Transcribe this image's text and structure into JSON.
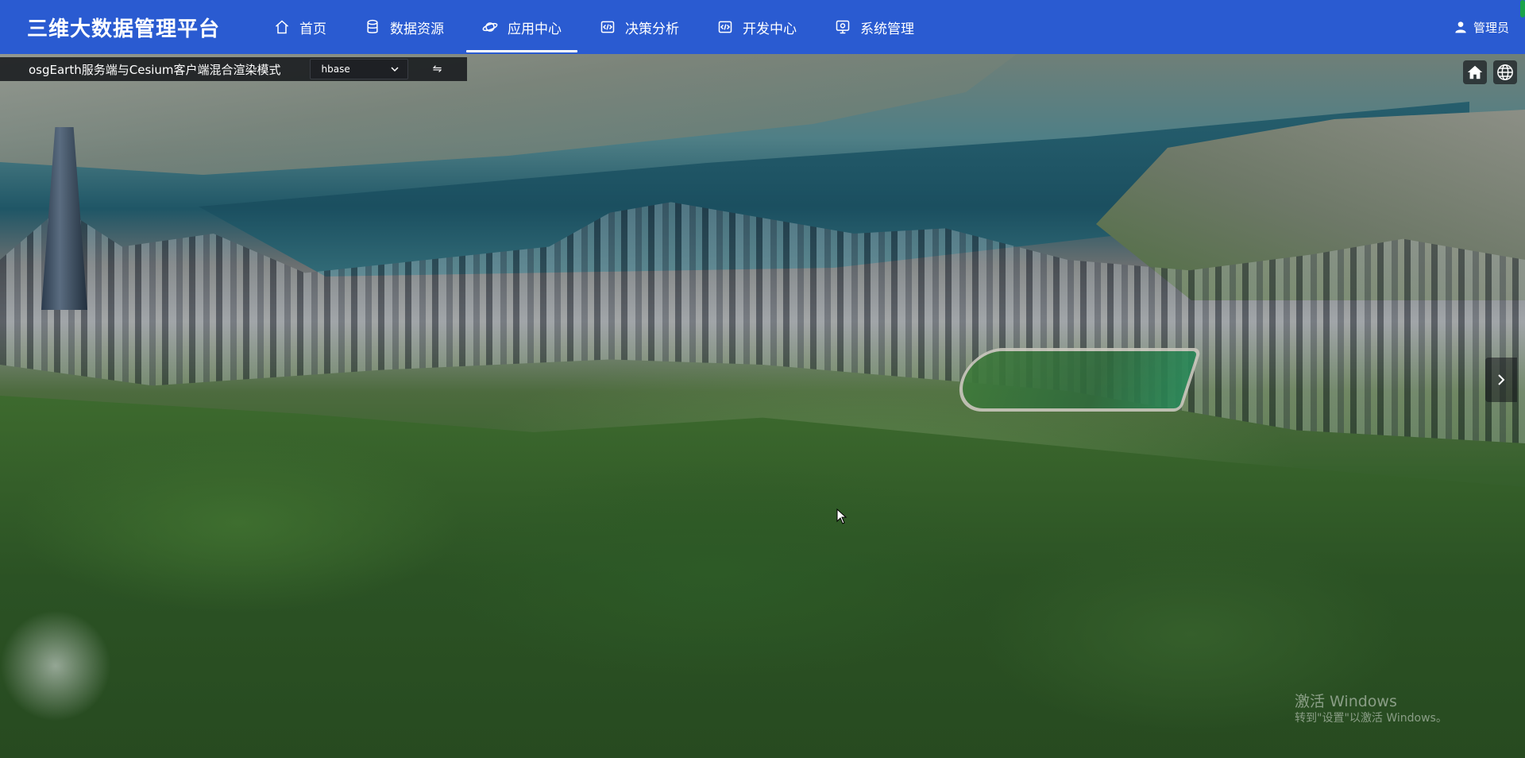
{
  "app": {
    "title": "三维大数据管理平台"
  },
  "nav": {
    "items": [
      {
        "label": "首页",
        "icon": "home-icon"
      },
      {
        "label": "数据资源",
        "icon": "database-icon"
      },
      {
        "label": "应用中心",
        "icon": "planet-icon",
        "active": true
      },
      {
        "label": "决策分析",
        "icon": "code-window-icon"
      },
      {
        "label": "开发中心",
        "icon": "code-window-icon"
      },
      {
        "label": "系统管理",
        "icon": "monitor-icon"
      }
    ]
  },
  "user": {
    "name": "管理员",
    "icon": "user-icon"
  },
  "toolbar": {
    "title": "osgEarth服务端与Cesium客户端混合渲染模式",
    "source_select": {
      "selected": "hbase"
    },
    "swap_label": "⇋"
  },
  "scene_controls": {
    "home_icon": "home-icon",
    "globe_icon": "globe-icon",
    "side_toggle_icon": "chevron-right-icon"
  },
  "watermark": {
    "line1": "激活 Windows",
    "line2": "转到\"设置\"以激活 Windows。"
  },
  "colors": {
    "nav_bar": "#2a5bd1",
    "toolbar_bg": "#14161a"
  }
}
